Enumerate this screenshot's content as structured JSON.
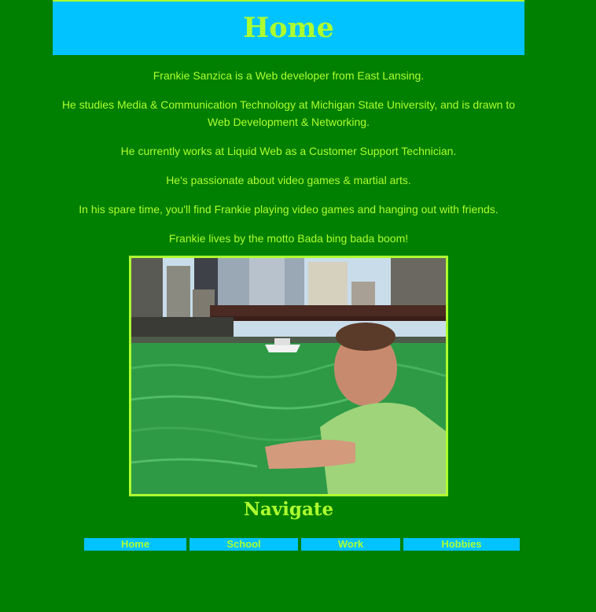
{
  "header": {
    "title": "Home"
  },
  "content": {
    "paragraphs": [
      "Frankie Sanzica is a Web developer from East Lansing.",
      "He studies Media & Communication Technology at Michigan State University, and is drawn to Web Development & Networking.",
      "He currently works at Liquid Web as a Customer Support Technician.",
      "He's passionate about video games & martial arts.",
      "In his spare time, you'll find Frankie playing video games and hanging out with friends.",
      "Frankie lives by the motto Bada bing bada boom!"
    ]
  },
  "photo": {
    "description_icon": "photo-of-frankie-by-green-river"
  },
  "navigation": {
    "title": "Navigate",
    "links": [
      {
        "label": "Home"
      },
      {
        "label": "School"
      },
      {
        "label": "Work"
      },
      {
        "label": "Hobbies"
      }
    ]
  },
  "colors": {
    "background": "#008000",
    "accent": "#adff2f",
    "header_bg": "#00c3ff"
  }
}
